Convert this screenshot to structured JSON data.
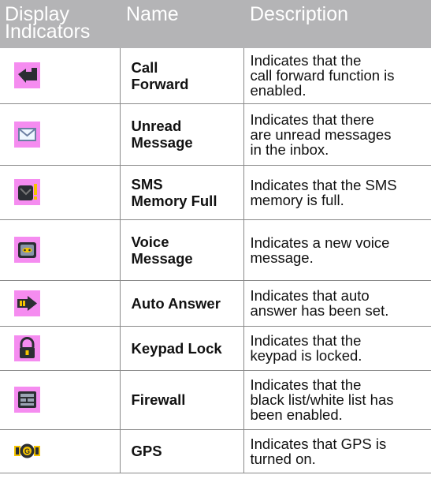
{
  "headers": {
    "display": [
      "Display",
      "Indicators"
    ],
    "name": "Name",
    "description": "Description"
  },
  "rows": [
    {
      "icon": "call-forward-icon",
      "name": [
        "Call",
        "Forward"
      ],
      "description": [
        "Indicates that the",
        "call forward function is",
        "enabled."
      ]
    },
    {
      "icon": "unread-message-icon",
      "name": [
        "Unread",
        "Message"
      ],
      "description": [
        "Indicates that there",
        "are unread messages",
        "in the inbox."
      ]
    },
    {
      "icon": "sms-memory-full-icon",
      "name": [
        "SMS",
        "Memory Full"
      ],
      "description": [
        "Indicates that the SMS",
        "memory is full."
      ]
    },
    {
      "icon": "voice-message-icon",
      "name": [
        "Voice",
        "Message"
      ],
      "description": [
        "Indicates a new voice",
        "message."
      ]
    },
    {
      "icon": "auto-answer-icon",
      "name": [
        "Auto Answer"
      ],
      "description": [
        "Indicates that auto",
        "answer has been set."
      ]
    },
    {
      "icon": "keypad-lock-icon",
      "name": [
        "Keypad Lock"
      ],
      "description": [
        "Indicates that the",
        "keypad is locked."
      ]
    },
    {
      "icon": "firewall-icon",
      "name": [
        "Firewall"
      ],
      "description": [
        "Indicates that the",
        "black list/white list has",
        "been enabled."
      ]
    },
    {
      "icon": "gps-icon",
      "name": [
        "GPS"
      ],
      "description": [
        "Indicates that GPS is",
        "turned on."
      ]
    }
  ],
  "colors": {
    "header_bg": "#b4b4b6",
    "icon_bg": "#f58cf0"
  }
}
